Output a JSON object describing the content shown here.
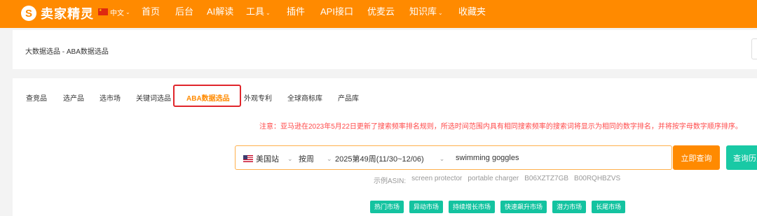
{
  "nav": {
    "logo_mark": "S",
    "logo_text": "卖家精灵",
    "lang": "中文",
    "items": [
      "首页",
      "后台",
      "AI解读",
      "工具",
      "插件",
      "API接口",
      "优麦云",
      "知识库",
      "收藏夹"
    ]
  },
  "breadcrumb": "大数据选品 - ABA数据选品",
  "tabs": [
    "查竞品",
    "选产品",
    "选市场",
    "关键词选品",
    "ABA数据选品",
    "外观专利",
    "全球商标库",
    "产品库"
  ],
  "active_tab": "ABA数据选品",
  "notice": "注意：亚马逊在2023年5月22日更新了搜索频率排名规则，所选时间范围内具有相同搜索频率的搜索词将显示为相同的数字排名，并将按字母数字顺序排序。",
  "search": {
    "marketplace": "美国站",
    "period_type": "按周",
    "week": "2025第49周(11/30~12/06)",
    "keyword": "swimming goggles",
    "query_button": "立即查询",
    "history_button": "查询历史"
  },
  "examples": {
    "label": "示例ASIN:",
    "items": [
      "screen protector",
      "portable charger",
      "B06XZTZ7GB",
      "B00RQHBZVS"
    ]
  },
  "market_tags": [
    "热门市场",
    "异动市场",
    "持续增长市场",
    "快速飙升市场",
    "潜力市场",
    "长尾市场"
  ],
  "colors": {
    "brand_orange": "#ff8a00",
    "notice_red": "#ff4a4a",
    "teal": "#14c3a0",
    "highlight_red": "#e0252b"
  }
}
